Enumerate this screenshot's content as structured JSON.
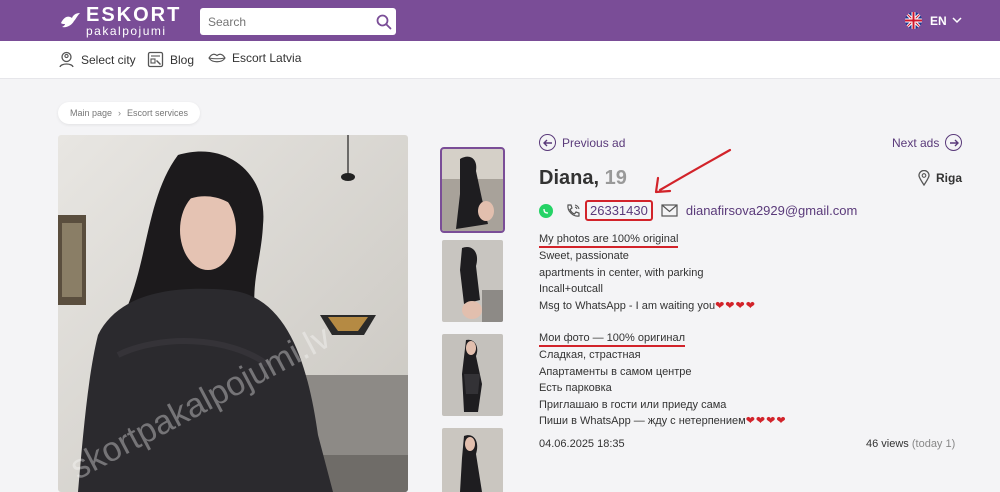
{
  "header": {
    "logo_top": "ESKORT",
    "logo_bottom": "pakalpojumi",
    "search_placeholder": "Search",
    "language": "EN"
  },
  "nav": {
    "items": [
      {
        "label": "Select city",
        "icon": "location-person-icon"
      },
      {
        "label": "Blog",
        "icon": "blog-icon"
      },
      {
        "label": "Escort Latvia",
        "icon": "lips-icon"
      }
    ]
  },
  "breadcrumb": [
    "Main page",
    "Escort services"
  ],
  "ad": {
    "prev_label": "Previous ad",
    "next_label": "Next ads",
    "name": "Diana,",
    "age": "19",
    "city": "Riga",
    "phone": "26331430",
    "email": "dianafirsova2929@gmail.com",
    "desc_en": [
      "My photos are 100% original",
      "Sweet, passionate",
      "apartments in center, with parking",
      "Incall+outcall",
      "Msg to WhatsApp - I am waiting you"
    ],
    "desc_ru": [
      "Мои фото — 100% оригинал",
      "Сладкая, страстная",
      "Апартаменты в самом центре",
      "Есть парковка",
      "Приглашаю в гости или приеду сама",
      "Пиши в WhatsApp — жду с нетерпением"
    ],
    "hearts": "❤❤❤❤",
    "date": "04.06.2025 18:35",
    "views": "46 views",
    "today": "(today 1)"
  },
  "colors": {
    "brand": "#7a4d97",
    "link": "#5a3a7a",
    "highlight": "#d2232a"
  }
}
